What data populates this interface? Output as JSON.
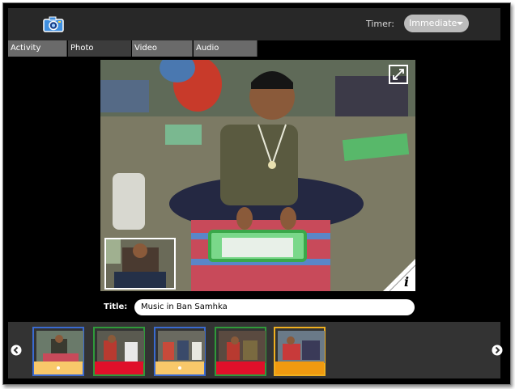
{
  "toolbar": {
    "timer_label": "Timer:",
    "timer_value": "Immediate",
    "camera_icon": "camera-icon"
  },
  "tabs": [
    {
      "label": "Activity",
      "active": false
    },
    {
      "label": "Photo",
      "active": true
    },
    {
      "label": "Video",
      "active": false
    },
    {
      "label": "Audio",
      "active": false
    }
  ],
  "viewer": {
    "fullscreen_icon": "fullscreen-icon",
    "info_label": "i",
    "title_label": "Title:",
    "title_value": "Music in Ban Samhka"
  },
  "tray": {
    "prev_icon": "chevron-left-icon",
    "next_icon": "chevron-right-icon",
    "thumbnails": [
      {
        "kind": "photo",
        "border_color": "#3a6ad0",
        "bar_color": "#f8c86a"
      },
      {
        "kind": "video",
        "border_color": "#2f9a3a",
        "bar_color": "#e0102a"
      },
      {
        "kind": "photo",
        "border_color": "#3a6ad0",
        "bar_color": "#f8c86a"
      },
      {
        "kind": "video",
        "border_color": "#2f9a3a",
        "bar_color": "#e0102a"
      },
      {
        "kind": "audio",
        "border_color": "#f0b020",
        "bar_color": "#f09a10"
      }
    ]
  },
  "colors": {
    "accent_blue": "#3a6ad0",
    "accent_green": "#2f9a3a",
    "accent_yellow": "#f0b020"
  }
}
